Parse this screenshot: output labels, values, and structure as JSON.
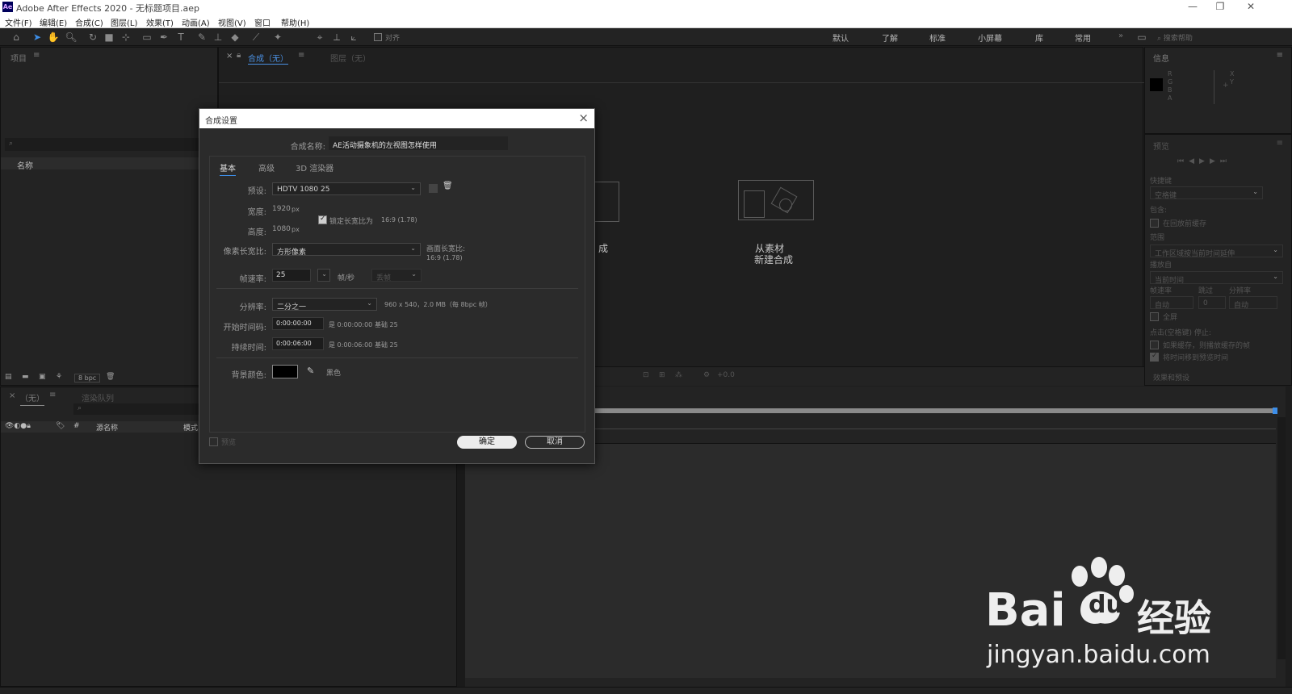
{
  "window": {
    "title": "Adobe After Effects 2020 - 无标题项目.aep",
    "logo": "Ae",
    "controls": [
      "—",
      "❐",
      "✕"
    ]
  },
  "menu": [
    "文件(F)",
    "编辑(E)",
    "合成(C)",
    "图层(L)",
    "效果(T)",
    "动画(A)",
    "视图(V)",
    "窗口",
    "帮助(H)"
  ],
  "toolbar": {
    "snap_label": "对齐",
    "workspaces": [
      "默认",
      "了解",
      "标准",
      "小屏幕",
      "库",
      "常用"
    ],
    "more": "»",
    "search_placeholder": "搜索帮助"
  },
  "project_panel": {
    "title": "项目",
    "column_name": "名称",
    "bpc": "8 bpc"
  },
  "composition_panel": {
    "tab": "合成（无）",
    "tab2": "图层（无）",
    "new_comp_partial": "成",
    "from_footage_line1": "从素材",
    "from_footage_line2": "新建合成",
    "zoom_value": "+0.0"
  },
  "info_panel": {
    "title": "信息",
    "channels": [
      "R",
      "G",
      "B",
      "A"
    ],
    "xy": [
      "X",
      "Y"
    ]
  },
  "preview_panel": {
    "title": "预览",
    "shortcut_label": "快捷键",
    "shortcut_value": "空格键",
    "include_label": "包含:",
    "cache_before_play": "在回放前缓存",
    "range_label": "范围",
    "range_value": "工作区域按当前时间延伸",
    "play_from_label": "播放自",
    "play_from_value": "当前时间",
    "framerate_label": "帧速率",
    "skip_label": "跳过",
    "resolution_label": "分辨率",
    "framerate_value": "自动",
    "skip_value": "0",
    "resolution_value": "自动",
    "fullscreen": "全屏",
    "stop_label": "点击(空格键) 停止:",
    "if_cached": "如果缓存，则播放缓存的帧",
    "move_time": "将时间移到预览时间",
    "effects_presets": "效果和预设"
  },
  "timeline_panel": {
    "tab": "（无）",
    "tab2": "渲染队列",
    "col_source": "源名称",
    "col_mode": "模式"
  },
  "dialog": {
    "title": "合成设置",
    "comp_name_label": "合成名称:",
    "comp_name_value": "AE活动摄象机的左视图怎样使用",
    "tabs": [
      "基本",
      "高级",
      "3D 渲染器"
    ],
    "preset_label": "预设:",
    "preset_value": "HDTV 1080 25",
    "width_label": "宽度:",
    "width_value": "1920",
    "height_label": "高度:",
    "height_value": "1080",
    "px": "px",
    "lock_aspect": "锁定长宽比为",
    "lock_aspect_value": "16:9 (1.78)",
    "pixel_aspect_label": "像素长宽比:",
    "pixel_aspect_value": "方形像素",
    "frame_aspect_label": "画面长宽比:",
    "frame_aspect_value": "16:9 (1.78)",
    "framerate_label": "帧速率:",
    "framerate_value": "25",
    "fps_unit": "帧/秒",
    "drop_frame": "丢帧",
    "resolution_label": "分辨率:",
    "resolution_value": "二分之一",
    "resolution_info": "960 x 540，2.0 MB（每 8bpc 帧）",
    "start_tc_label": "开始时间码:",
    "start_tc_value": "0:00:00:00",
    "start_tc_is": "是 0:00:00:00",
    "start_tc_base": "基础 25",
    "duration_label": "持续时间:",
    "duration_value": "0:00:06:00",
    "duration_is": "是 0:00:06:00",
    "duration_base": "基础 25",
    "bg_color_label": "背景颜色:",
    "bg_color_name": "黑色",
    "bg_color": "#000000",
    "preview_label": "预览",
    "ok_label": "确定",
    "cancel_label": "取消"
  },
  "watermark": {
    "brand": "Bai",
    "brand_du": "du",
    "brand_cn": "经验",
    "url": "jingyan.baidu.com"
  },
  "colors": {
    "accent_blue": "#3d8ee8",
    "panel_bg": "#232323",
    "dialog_bg": "#2b2b2b"
  }
}
